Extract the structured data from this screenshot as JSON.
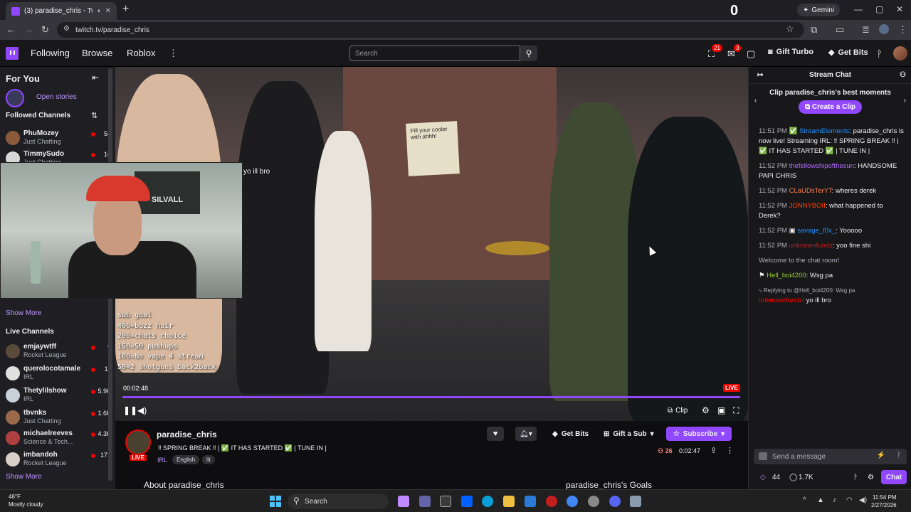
{
  "browser": {
    "tab_title": "(3) paradise_chris - Twitch",
    "address": "twitch.tv/paradise_chris",
    "gemini_label": "Gemini",
    "center_glyph": "0"
  },
  "topnav": {
    "following": "Following",
    "browse": "Browse",
    "roblox": "Roblox",
    "search_placeholder": "Search",
    "notif_badge_1": "21",
    "notif_badge_2": "3",
    "gift_turbo": "Gift Turbo",
    "get_bits": "Get Bits"
  },
  "sidebar": {
    "for_you": "For You",
    "open_stories": "Open stories",
    "followed_title": "Followed Channels",
    "followed": [
      {
        "name": "PhuMozey",
        "category": "Just Chatting",
        "viewers": "54"
      },
      {
        "name": "TimmySudo",
        "category": "Just Chatting",
        "viewers": "16"
      }
    ],
    "show_more_1": "Show More",
    "live_title": "Live Channels",
    "live": [
      {
        "name": "emjaywtff",
        "category": "Rocket League",
        "viewers": "9"
      },
      {
        "name": "querolocotamale",
        "category": "IRL",
        "viewers": "11"
      },
      {
        "name": "Thetylilshow",
        "category": "IRL",
        "viewers": "5.9K"
      },
      {
        "name": "tbvnks",
        "category": "Just Chatting",
        "viewers": "1.6K"
      },
      {
        "name": "michaelreeves",
        "category": "Science & Tech...",
        "viewers": "4.3K"
      },
      {
        "name": "imbandoh",
        "category": "Rocket League",
        "viewers": "171"
      }
    ],
    "show_more_2": "Show More"
  },
  "video": {
    "overlay_text": "yo ill bro",
    "sign_text": "Fill your cooler with ahhh!",
    "goals": [
      "sub goal",
      "400=buzz hair",
      "200=chats choice",
      "150=50 pushups",
      "100=No vape 4 stream",
      "50=2 shotguns back2back"
    ],
    "timestamp": "00:02:48",
    "live": "LIVE",
    "clip": "Clip",
    "cam_flag": "SILVALL"
  },
  "stream": {
    "channel": "paradise_chris",
    "live": "LIVE",
    "title": "‼ SPRING BREAK ‼ | ✅ IT HAS STARTED ✅ | TUNE IN |",
    "category": "IRL",
    "tags": [
      "English",
      "lit"
    ],
    "get_bits": "Get Bits",
    "gift_sub": "Gift a Sub",
    "subscribe": "Subscribe",
    "viewers": "26",
    "uptime": "0:02:47",
    "about": "About paradise_chris",
    "goals_title": "paradise_chris's Goals"
  },
  "chat": {
    "title": "Stream Chat",
    "promo_title": "Clip paradise_chris's best moments",
    "create_clip": "Create a Clip",
    "messages": [
      {
        "time": "11:51 PM",
        "user": "StreamElements",
        "text": "paradise_chris is now live! Streaming IRL: ‼ SPRING BREAK ‼ | ✅ IT HAS STARTED ✅ | TUNE IN |"
      },
      {
        "time": "11:52 PM",
        "user": "thefellowshipofthesun",
        "text": "HANDSOME PAPI CHRIS"
      },
      {
        "time": "11:52 PM",
        "user": "CLaUDsTerYT",
        "text": "wheres derek"
      },
      {
        "time": "11:52 PM",
        "user": "JONNYBOII",
        "text": "what happened to Derek?"
      },
      {
        "time": "11:52 PM",
        "user": "savage_f0x_",
        "text": "Yooooo"
      },
      {
        "time": "11:52 PM",
        "user": "unknownfundz",
        "text": "yoo fine shi"
      }
    ],
    "welcome": "Welcome to the chat room!",
    "hell_user": "Hell_boi4200",
    "hell_text": "Wsg pa",
    "reply_ctx": "Replying to @Hell_boi4200: Wsg pa",
    "reply_user": "unknownfundz",
    "reply_text": "yo ill bro",
    "input_placeholder": "Send a message",
    "points": "44",
    "bits": "1.7K",
    "chat_button": "Chat"
  },
  "taskbar": {
    "temp": "46°F",
    "weather": "Mostly cloudy",
    "search": "Search",
    "time": "11:54 PM",
    "date": "2/27/2026"
  }
}
